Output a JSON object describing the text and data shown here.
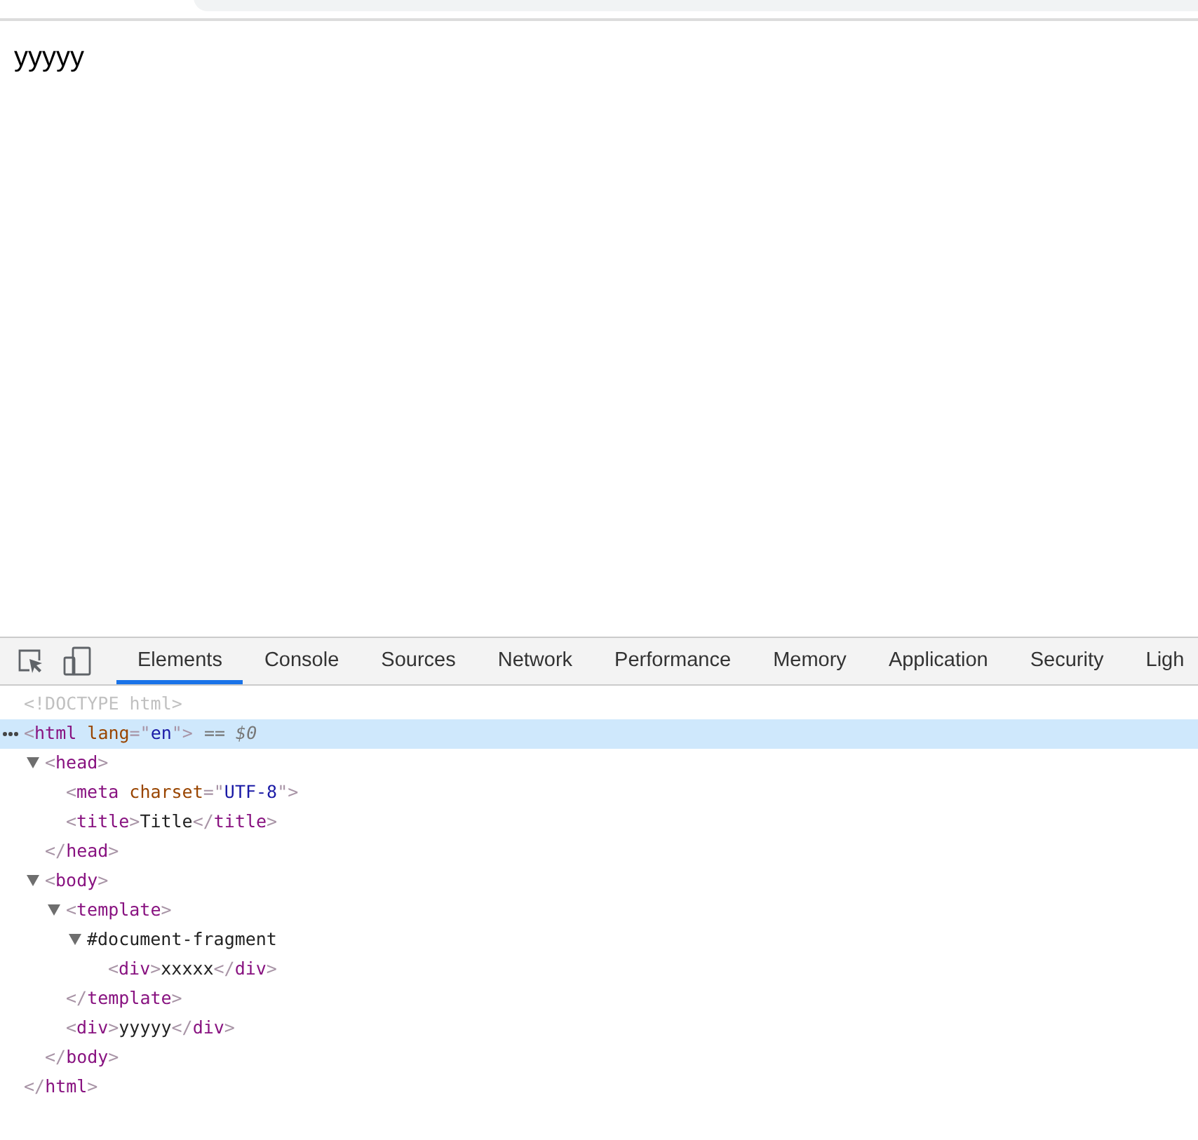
{
  "page": {
    "text": "yyyyy"
  },
  "devtools": {
    "tabs": [
      {
        "label": "Elements",
        "selected": true
      },
      {
        "label": "Console",
        "selected": false
      },
      {
        "label": "Sources",
        "selected": false
      },
      {
        "label": "Network",
        "selected": false
      },
      {
        "label": "Performance",
        "selected": false
      },
      {
        "label": "Memory",
        "selected": false
      },
      {
        "label": "Application",
        "selected": false
      },
      {
        "label": "Security",
        "selected": false
      },
      {
        "label": "Ligh",
        "selected": false
      }
    ],
    "dom_tree": [
      {
        "tokens": [
          {
            "kind": "doctype",
            "text": "<!DOCTYPE html>"
          }
        ],
        "selected": false
      },
      {
        "tokens": [
          {
            "kind": "punct",
            "text": "<"
          },
          {
            "kind": "tag",
            "text": "html"
          },
          {
            "kind": "attr",
            "text": " lang"
          },
          {
            "kind": "punct",
            "text": "=\""
          },
          {
            "kind": "value",
            "text": "en"
          },
          {
            "kind": "punct",
            "text": "\">"
          }
        ],
        "marker": "== $0",
        "selected": true,
        "children": [
          {
            "tokens": [
              {
                "kind": "punct",
                "text": "<"
              },
              {
                "kind": "tag",
                "text": "head"
              },
              {
                "kind": "punct",
                "text": ">"
              }
            ],
            "expanded": true,
            "selected": false,
            "children": [
              {
                "tokens": [
                  {
                    "kind": "punct",
                    "text": "<"
                  },
                  {
                    "kind": "tag",
                    "text": "meta"
                  },
                  {
                    "kind": "attr",
                    "text": " charset"
                  },
                  {
                    "kind": "punct",
                    "text": "=\""
                  },
                  {
                    "kind": "value",
                    "text": "UTF-8"
                  },
                  {
                    "kind": "punct",
                    "text": "\">"
                  }
                ],
                "selected": false
              },
              {
                "tokens": [
                  {
                    "kind": "punct",
                    "text": "<"
                  },
                  {
                    "kind": "tag",
                    "text": "title"
                  },
                  {
                    "kind": "punct",
                    "text": ">"
                  },
                  {
                    "kind": "text",
                    "text": "Title"
                  },
                  {
                    "kind": "punct",
                    "text": "</"
                  },
                  {
                    "kind": "tag",
                    "text": "title"
                  },
                  {
                    "kind": "punct",
                    "text": ">"
                  }
                ],
                "selected": false
              }
            ],
            "closing": [
              {
                "kind": "punct",
                "text": "</"
              },
              {
                "kind": "tag",
                "text": "head"
              },
              {
                "kind": "punct",
                "text": ">"
              }
            ]
          },
          {
            "tokens": [
              {
                "kind": "punct",
                "text": "<"
              },
              {
                "kind": "tag",
                "text": "body"
              },
              {
                "kind": "punct",
                "text": ">"
              }
            ],
            "expanded": true,
            "selected": false,
            "children": [
              {
                "tokens": [
                  {
                    "kind": "punct",
                    "text": "<"
                  },
                  {
                    "kind": "tag",
                    "text": "template"
                  },
                  {
                    "kind": "punct",
                    "text": ">"
                  }
                ],
                "expanded": true,
                "selected": false,
                "children": [
                  {
                    "tokens": [
                      {
                        "kind": "text",
                        "text": "#document-fragment"
                      }
                    ],
                    "expanded": true,
                    "selected": false,
                    "children": [
                      {
                        "tokens": [
                          {
                            "kind": "punct",
                            "text": "<"
                          },
                          {
                            "kind": "tag",
                            "text": "div"
                          },
                          {
                            "kind": "punct",
                            "text": ">"
                          },
                          {
                            "kind": "text",
                            "text": "xxxxx"
                          },
                          {
                            "kind": "punct",
                            "text": "</"
                          },
                          {
                            "kind": "tag",
                            "text": "div"
                          },
                          {
                            "kind": "punct",
                            "text": ">"
                          }
                        ],
                        "selected": false
                      }
                    ]
                  }
                ],
                "closing": [
                  {
                    "kind": "punct",
                    "text": "</"
                  },
                  {
                    "kind": "tag",
                    "text": "template"
                  },
                  {
                    "kind": "punct",
                    "text": ">"
                  }
                ]
              },
              {
                "tokens": [
                  {
                    "kind": "punct",
                    "text": "<"
                  },
                  {
                    "kind": "tag",
                    "text": "div"
                  },
                  {
                    "kind": "punct",
                    "text": ">"
                  },
                  {
                    "kind": "text",
                    "text": "yyyyy"
                  },
                  {
                    "kind": "punct",
                    "text": "</"
                  },
                  {
                    "kind": "tag",
                    "text": "div"
                  },
                  {
                    "kind": "punct",
                    "text": ">"
                  }
                ],
                "selected": false
              }
            ],
            "closing": [
              {
                "kind": "punct",
                "text": "</"
              },
              {
                "kind": "tag",
                "text": "body"
              },
              {
                "kind": "punct",
                "text": ">"
              }
            ]
          }
        ],
        "closing": [
          {
            "kind": "punct",
            "text": "</"
          },
          {
            "kind": "tag",
            "text": "html"
          },
          {
            "kind": "punct",
            "text": ">"
          }
        ]
      }
    ]
  }
}
